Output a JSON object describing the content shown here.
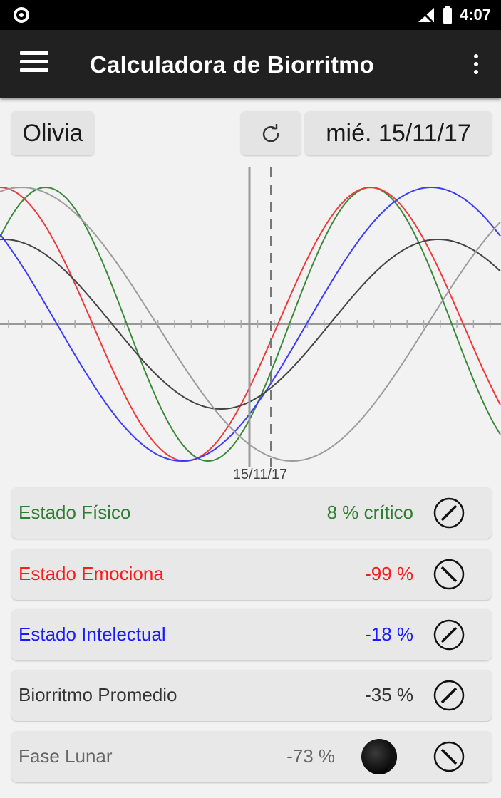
{
  "status_bar": {
    "time": "4:07"
  },
  "app_bar": {
    "title": "Calculadora de Biorritmo"
  },
  "controls": {
    "name": "Olivia",
    "date": "mié. 15/11/17"
  },
  "chart_data": {
    "type": "line",
    "x_label_center": "15/11/17",
    "series": [
      {
        "color": "#3a8a3a"
      },
      {
        "color": "#ee3a3a"
      },
      {
        "color": "#3b3bff"
      },
      {
        "color": "#444444"
      },
      {
        "color": "#9c9c9c"
      }
    ]
  },
  "stats": [
    {
      "label": "Estado Físico",
      "value": "8 % crítico",
      "color": "#2e7d32",
      "icon": "rising-slash-icon"
    },
    {
      "label": "Estado Emociona",
      "value": "-99 %",
      "color": "#ff1a1a",
      "icon": "falling-slash-icon"
    },
    {
      "label": "Estado Intelectual",
      "value": "-18 %",
      "color": "#1a1aff",
      "icon": "rising-slash-icon"
    },
    {
      "label": "Biorritmo Promedio",
      "value": "-35 %",
      "color": "#333333",
      "icon": "rising-slash-icon"
    },
    {
      "label": "Fase Lunar",
      "value": "-73 %",
      "color": "#666666",
      "icon": "falling-slash-icon"
    }
  ]
}
